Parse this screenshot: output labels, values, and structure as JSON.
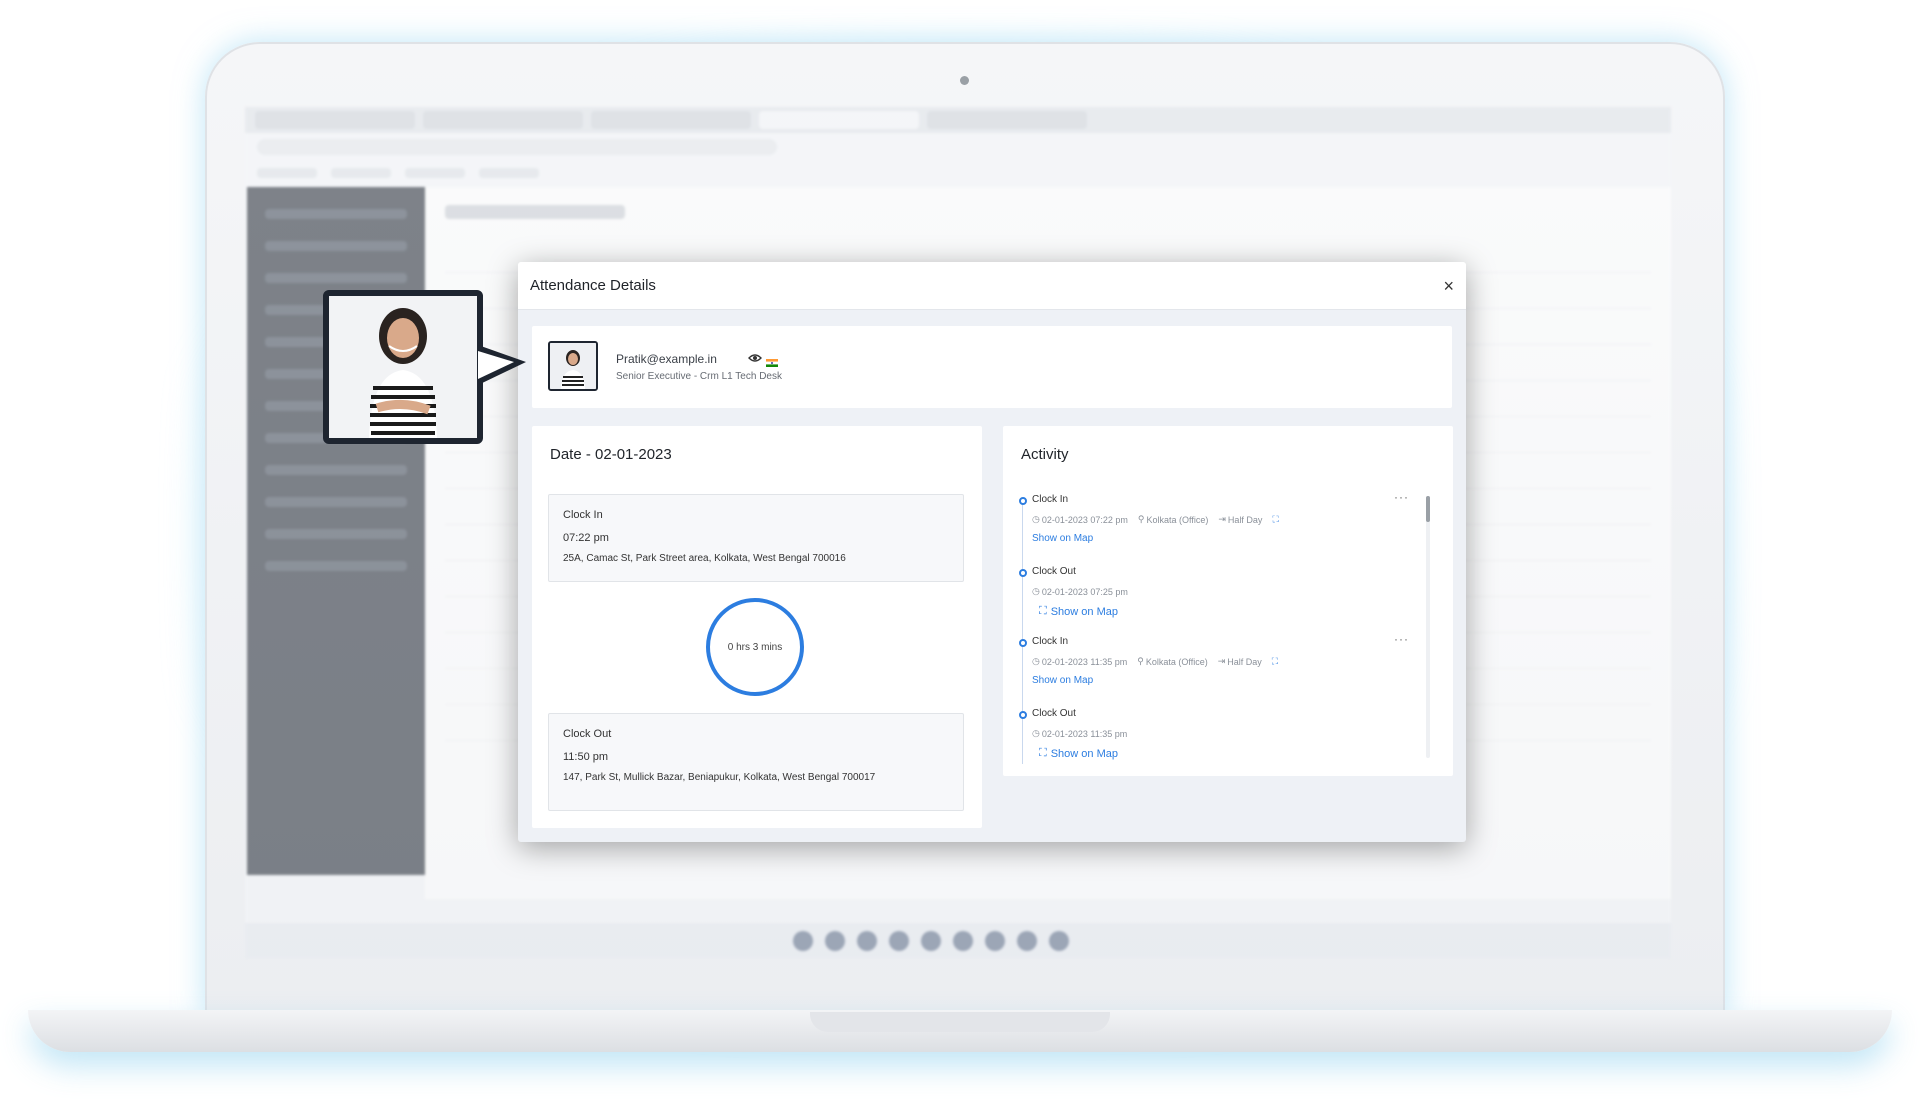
{
  "modal": {
    "title": "Attendance Details",
    "close_label": "×"
  },
  "user": {
    "email": "Pratik@example.in",
    "role": "Senior Executive - Crm L1 Tech Desk"
  },
  "date_panel": {
    "title": "Date - 02-01-2023",
    "clock_in": {
      "label": "Clock In",
      "time": "07:22 pm",
      "address": "25A, Camac St, Park Street area, Kolkata, West Bengal 700016"
    },
    "duration": "0 hrs 3 mins",
    "clock_out": {
      "label": "Clock Out",
      "time": "11:50 pm",
      "address": "147, Park St, Mullick Bazar, Beniapukur, Kolkata, West Bengal 700017"
    }
  },
  "activity": {
    "title": "Activity",
    "items": [
      {
        "label": "Clock In",
        "datetime": "02-01-2023 07:22 pm",
        "location": "Kolkata (Office)",
        "status": "Half Day",
        "link": "Show on Map",
        "more": "···"
      },
      {
        "label": "Clock Out",
        "datetime": "02-01-2023 07:25 pm",
        "link": "Show on Map"
      },
      {
        "label": "Clock In",
        "datetime": "02-01-2023 11:35 pm",
        "location": "Kolkata (Office)",
        "status": "Half Day",
        "link": "Show on Map",
        "more": "···"
      },
      {
        "label": "Clock Out",
        "datetime": "02-01-2023 11:35 pm",
        "link": "Show on Map"
      }
    ]
  },
  "colors": {
    "accent": "#2c7de0",
    "sidebar": "#1e2530"
  }
}
